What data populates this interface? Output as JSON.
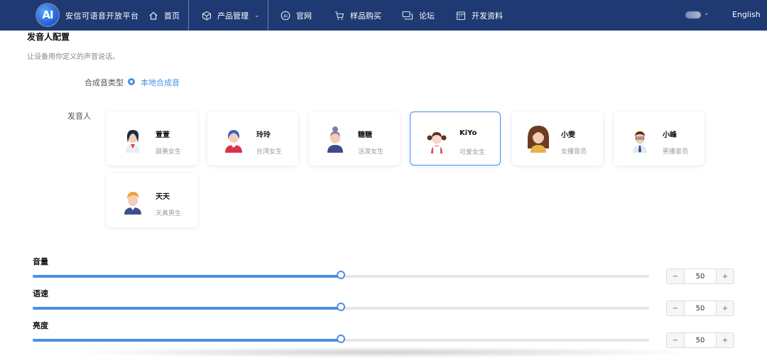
{
  "brand": {
    "logo_text": "AI",
    "name": "安信可语音开放平台"
  },
  "nav": {
    "items": [
      {
        "label": "首页",
        "icon": "home-icon"
      },
      {
        "label": "产品管理",
        "icon": "box-icon"
      },
      {
        "label": "官网",
        "icon": "ai-circle-icon"
      },
      {
        "label": "样品购买",
        "icon": "cart-icon"
      },
      {
        "label": "论坛",
        "icon": "chat-icon"
      },
      {
        "label": "开发资料",
        "icon": "calendar-icon"
      }
    ],
    "language": "English"
  },
  "section": {
    "title": "发音人配置",
    "desc": "让设备用你定义的声音说话。"
  },
  "synth": {
    "label": "合成音类型",
    "option": "本地合成音"
  },
  "speakers": {
    "label": "发音人",
    "items": [
      {
        "name": "萱萱",
        "desc": "甜美女生",
        "avatar": "girl-dark-hair-icon"
      },
      {
        "name": "玲玲",
        "desc": "台湾女生",
        "avatar": "girl-blue-hair-icon"
      },
      {
        "name": "糖糖",
        "desc": "活泼女生",
        "avatar": "girl-bun-icon"
      },
      {
        "name": "KiYo",
        "desc": "可爱女生",
        "avatar": "girl-pigtails-icon"
      },
      {
        "name": "小雯",
        "desc": "女播音员",
        "avatar": "woman-brown-hair-icon"
      },
      {
        "name": "小峰",
        "desc": "男播音员",
        "avatar": "man-glasses-icon"
      },
      {
        "name": "天天",
        "desc": "天真男生",
        "avatar": "boy-orange-hair-icon"
      }
    ],
    "selected": "KiYo"
  },
  "sliders": [
    {
      "label": "音量",
      "value": "50",
      "fraction": 0.5
    },
    {
      "label": "语速",
      "value": "50",
      "fraction": 0.5
    },
    {
      "label": "亮度",
      "value": "50",
      "fraction": 0.5
    }
  ],
  "stepper": {
    "minus": "−",
    "plus": "+"
  },
  "colors": {
    "nav_bg": "#1f3a73",
    "accent": "#4a90e2"
  }
}
